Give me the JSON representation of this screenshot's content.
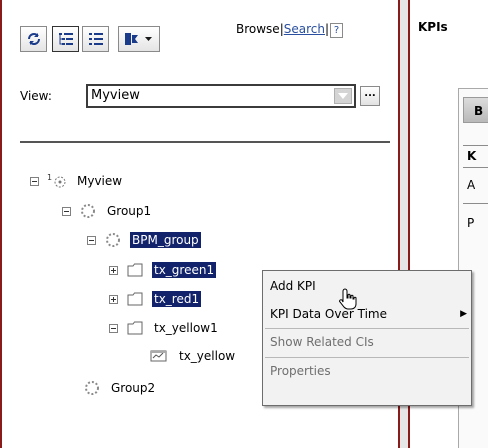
{
  "toolbar": {
    "browse_label": "Browse",
    "separator": "|",
    "search_label": "Search",
    "help_label": "?"
  },
  "view": {
    "label": "View:",
    "value": "Myview",
    "more_label": "..."
  },
  "tree": {
    "root": "Myview",
    "group1": "Group1",
    "bpm_group": "BPM_group",
    "tx_green1": "tx_green1",
    "tx_red1": "tx_red1",
    "tx_yellow1": "tx_yellow1",
    "tx_yellow_child": "tx_yellow",
    "group2": "Group2"
  },
  "context_menu": {
    "items": [
      {
        "label": "Add KPI",
        "enabled": true
      },
      {
        "label": "KPI Data Over Time",
        "enabled": true,
        "submenu": true
      },
      {
        "label": "Show Related CIs",
        "enabled": false
      },
      {
        "label": "Properties",
        "enabled": false
      }
    ],
    "submenu_arrow": "▶"
  },
  "right_panel": {
    "title": "KPIs",
    "tab_label": "B",
    "header_cell": "K",
    "row1": "A",
    "row2": "P"
  },
  "colors": {
    "frame": "#8a1b1b",
    "selection": "#12236b",
    "link": "#2a4f9e"
  },
  "icons": [
    "refresh-icon",
    "tree-view-icon",
    "list-view-icon",
    "filter-dropdown-icon",
    "dropdown-arrow-icon",
    "view-root-icon",
    "group-icon",
    "transaction-icon",
    "monitor-icon",
    "hand-cursor-icon"
  ]
}
